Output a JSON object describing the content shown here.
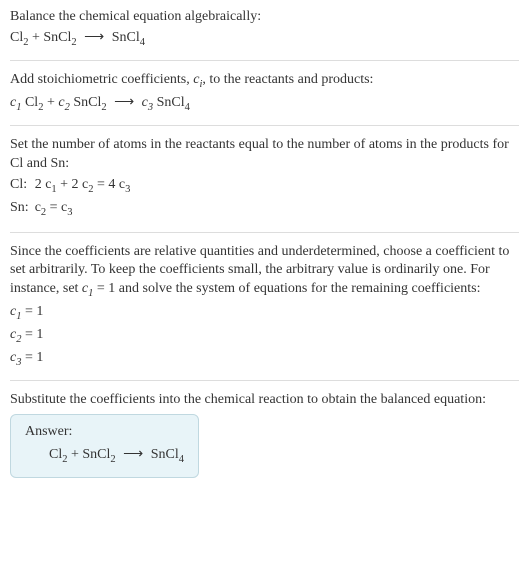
{
  "problem": {
    "instruction": "Balance the chemical equation algebraically:",
    "reactant1": "Cl",
    "reactant1_sub": "2",
    "reactant2a": "SnCl",
    "reactant2_sub": "2",
    "product1": "SnCl",
    "product1_sub": "4",
    "arrow": "⟶",
    "plus": " + "
  },
  "step2": {
    "text": "Add stoichiometric coefficients, ",
    "ci": "c",
    "ci_sub": "i",
    "text2": ", to the reactants and products:",
    "c1": "c",
    "c1_sub": "1",
    "c2": "c",
    "c2_sub": "2",
    "c3": "c",
    "c3_sub": "3",
    "r1": "Cl",
    "r1_sub": "2",
    "r2": "SnCl",
    "r2_sub": "2",
    "p1": "SnCl",
    "p1_sub": "4"
  },
  "step3": {
    "text": "Set the number of atoms in the reactants equal to the number of atoms in the products for Cl and Sn:",
    "rows": [
      {
        "label": "Cl:",
        "lhs": "2 c",
        "lhs_s1": "1",
        "mid": " + 2 c",
        "lhs_s2": "2",
        "eq": " = 4 c",
        "rhs_s": "3"
      },
      {
        "label": "Sn:",
        "lhs": "c",
        "lhs_s1": "2",
        "mid": "",
        "lhs_s2": "",
        "eq": " = c",
        "rhs_s": "3"
      }
    ]
  },
  "step4": {
    "text": "Since the coefficients are relative quantities and underdetermined, choose a coefficient to set arbitrarily. To keep the coefficients small, the arbitrary value is ordinarily one. For instance, set ",
    "cset": "c",
    "cset_sub": "1",
    "cset_val": " = 1",
    "text2": " and solve the system of equations for the remaining coefficients:",
    "results": [
      {
        "c": "c",
        "sub": "1",
        "val": " = 1"
      },
      {
        "c": "c",
        "sub": "2",
        "val": " = 1"
      },
      {
        "c": "c",
        "sub": "3",
        "val": " = 1"
      }
    ]
  },
  "step5": {
    "text": "Substitute the coefficients into the chemical reaction to obtain the balanced equation:"
  },
  "answer": {
    "label": "Answer:",
    "r1": "Cl",
    "r1_sub": "2",
    "plus": " + ",
    "r2": "SnCl",
    "r2_sub": "2",
    "arrow": "⟶",
    "p1": "SnCl",
    "p1_sub": "4"
  },
  "chart_data": {
    "type": "table",
    "title": "Stoichiometric coefficients",
    "coefficients": {
      "c1": 1,
      "c2": 1,
      "c3": 1
    },
    "atom_balance": {
      "Cl": "2 c1 + 2 c2 = 4 c3",
      "Sn": "c2 = c3"
    },
    "balanced_equation": "Cl2 + SnCl2 ⟶ SnCl4"
  }
}
